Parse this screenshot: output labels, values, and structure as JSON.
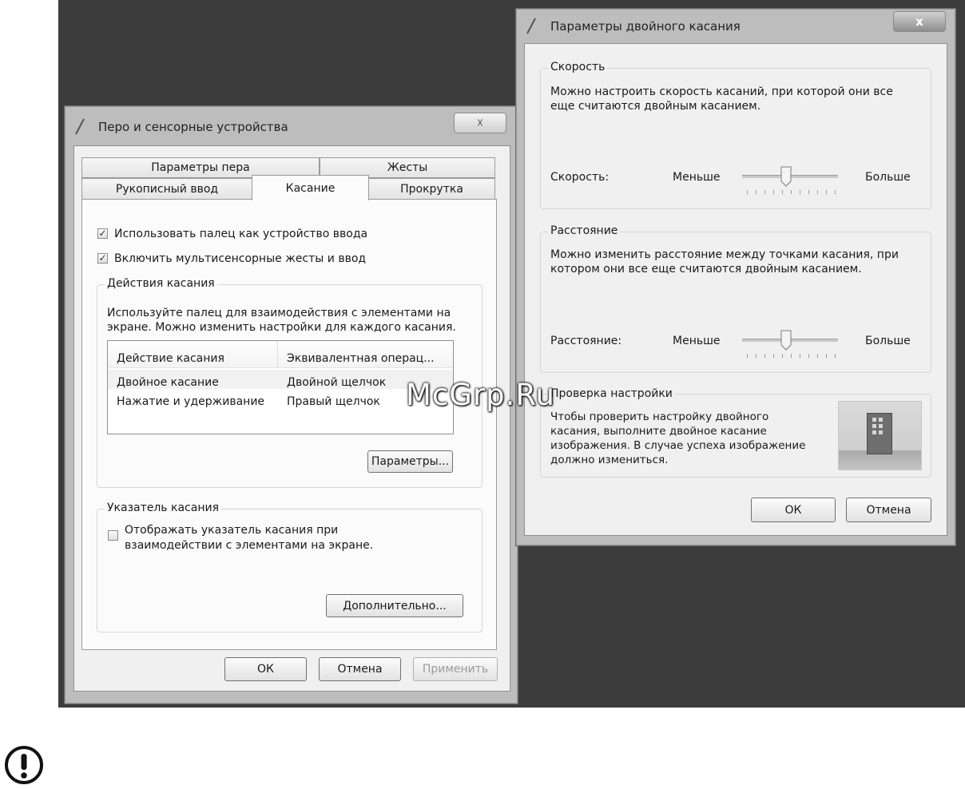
{
  "left_window": {
    "title": "Перо и сенсорные устройства",
    "close_glyph": "☓",
    "tabs_row_top": [
      "Параметры пера",
      "Жесты"
    ],
    "tabs_row_bottom": [
      "Рукописный ввод",
      "Касание",
      "Прокрутка"
    ],
    "active_tab": "Касание",
    "checkbox_use_finger": {
      "label": "Использовать палец как устройство ввода",
      "checked": true
    },
    "checkbox_multitouch": {
      "label": "Включить мультисенсорные жесты и ввод",
      "checked": true
    },
    "touch_actions": {
      "group_label": "Действия касания",
      "description_line1": "Используйте палец для взаимодействия с элементами на",
      "description_line2": "экране. Можно изменить настройки для каждого касания.",
      "columns": [
        "Действие касания",
        "Эквивалентная операц..."
      ],
      "rows": [
        [
          "Двойное касание",
          "Двойной щелчок"
        ],
        [
          "Нажатие и удерживание",
          "Правый щелчок"
        ]
      ],
      "settings_button": "Параметры..."
    },
    "touch_pointer": {
      "group_label": "Указатель касания",
      "checkbox_line1": "Отображать указатель касания при",
      "checkbox_line2": "взаимодействии с элементами на экране.",
      "checked": false,
      "advanced_button": "Дополнительно..."
    },
    "ok_button": "ОК",
    "cancel_button": "Отмена",
    "apply_button": "Применить"
  },
  "right_window": {
    "title": "Параметры двойного касания",
    "close_glyph": "x",
    "speed": {
      "group_label": "Скорость",
      "description_line1": "Можно настроить скорость касаний, при которой они все",
      "description_line2": "еще считаются двойным касанием.",
      "slider_label": "Скорость:",
      "min_label": "Меньше",
      "max_label": "Больше",
      "value_fraction": 0.45
    },
    "distance": {
      "group_label": "Расстояние",
      "description_line1": "Можно изменить расстояние между точками касания, при",
      "description_line2": "котором они все еще считаются двойным касанием.",
      "slider_label": "Расстояние:",
      "min_label": "Меньше",
      "max_label": "Больше",
      "value_fraction": 0.45
    },
    "test": {
      "group_label": "Проверка настройки",
      "line1": "Чтобы проверить настройку двойного",
      "line2": "касания, выполните двойное касание",
      "line3": "изображения. В случае успеха изображение",
      "line4": "должно измениться."
    },
    "ok_button": "ОК",
    "cancel_button": "Отмена"
  },
  "watermark": "McGrp.Ru",
  "warning_icon": "exclamation-circle-icon"
}
